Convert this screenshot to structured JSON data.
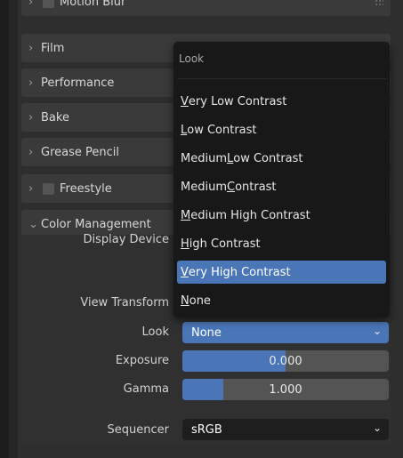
{
  "sections": [
    {
      "key": "motion_blur",
      "label": "Motion Blur",
      "checkbox": true
    },
    {
      "key": "film",
      "label": "Film"
    },
    {
      "key": "performance",
      "label": "Performance"
    },
    {
      "key": "bake",
      "label": "Bake"
    },
    {
      "key": "grease_pencil",
      "label": "Grease Pencil"
    },
    {
      "key": "freestyle",
      "label": "Freestyle",
      "checkbox": true
    },
    {
      "key": "color_management",
      "label": "Color Management",
      "expanded": true
    }
  ],
  "color_management": {
    "display_device_label": "Display Device",
    "view_transform_label": "View Transform",
    "look_label": "Look",
    "look_value": "None",
    "exposure_label": "Exposure",
    "exposure_value": "0.000",
    "gamma_label": "Gamma",
    "gamma_value": "1.000",
    "gamma_fill": 0.2,
    "sequencer_label": "Sequencer",
    "sequencer_value": "sRGB"
  },
  "look_menu": {
    "title": "Look",
    "selected_index": 6,
    "items": [
      {
        "pre": "",
        "ul": "V",
        "post": "ery Low Contrast"
      },
      {
        "pre": "",
        "ul": "L",
        "post": "ow Contrast"
      },
      {
        "pre": "Medium ",
        "ul": "L",
        "post": "ow Contrast"
      },
      {
        "pre": "Medium ",
        "ul": "C",
        "post": "ontrast"
      },
      {
        "pre": "",
        "ul": "M",
        "post": "edium High Contrast"
      },
      {
        "pre": "",
        "ul": "H",
        "post": "igh Contrast"
      },
      {
        "pre": "",
        "ul": "V",
        "post": "ery High Contrast"
      },
      {
        "pre": "",
        "ul": "N",
        "post": "one"
      }
    ]
  },
  "colors": {
    "accent": "#4a76b8",
    "panel": "#3a3a3a",
    "menu": "#181818"
  }
}
